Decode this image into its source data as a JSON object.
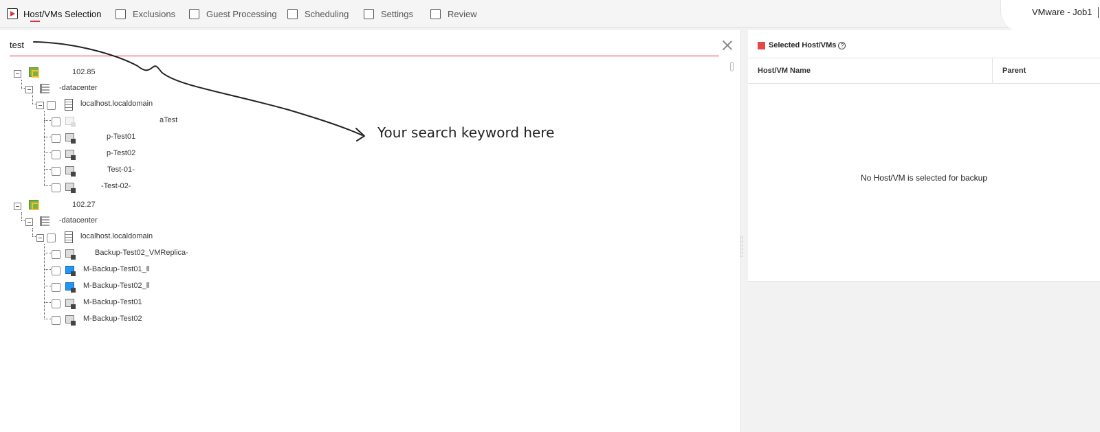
{
  "wizard": {
    "steps": [
      {
        "label": "Host/VMs Selection",
        "active": true
      },
      {
        "label": "Exclusions"
      },
      {
        "label": "Guest Processing"
      },
      {
        "label": "Scheduling"
      },
      {
        "label": "Settings"
      },
      {
        "label": "Review"
      }
    ],
    "job_title": "VMware - Job1"
  },
  "search": {
    "value": "test"
  },
  "tree": {
    "groups": [
      {
        "vcenter": "102.85",
        "datacenter": "-datacenter",
        "host": "localhost.localdomain",
        "vms": [
          {
            "label": "aTest",
            "icon": "vm-ghost-icon",
            "faded": true
          },
          {
            "label": "p-Test01",
            "icon": "vm-icon"
          },
          {
            "label": "p-Test02",
            "icon": "vm-icon"
          },
          {
            "label": "Test-01-",
            "icon": "vm-icon"
          },
          {
            "label": "-Test-02-",
            "icon": "vm-icon"
          }
        ]
      },
      {
        "vcenter": "102.27",
        "datacenter": "-datacenter",
        "host": "localhost.localdomain",
        "vms": [
          {
            "label": "Backup-Test02_VMReplica-",
            "icon": "vm-icon"
          },
          {
            "label": "M-Backup-Test01_ll",
            "icon": "vm-blue-icon"
          },
          {
            "label": "M-Backup-Test02_ll",
            "icon": "vm-blue-icon"
          },
          {
            "label": "M-Backup-Test01",
            "icon": "vm-icon"
          },
          {
            "label": "M-Backup-Test02",
            "icon": "vm-icon"
          }
        ]
      }
    ]
  },
  "annotation": {
    "text": "Your search keyword here"
  },
  "selected_panel": {
    "title": "Selected Host/VMs",
    "columns": {
      "name": "Host/VM Name",
      "parent": "Parent"
    },
    "empty_message": "No Host/VM is selected for backup"
  },
  "colors": {
    "accent": "#e0313a",
    "swatch": "#e54848",
    "vcenter": "#7cb342",
    "vm_blue": "#2196f3"
  }
}
